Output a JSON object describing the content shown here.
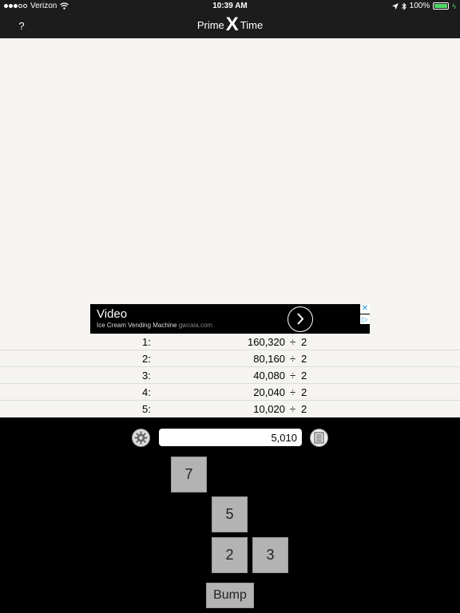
{
  "status_bar": {
    "carrier": "Verizon",
    "time": "10:39 AM",
    "battery_percent": "100%",
    "battery_level": 1.0,
    "signal_bars_filled": 3,
    "signal_bars_total": 5
  },
  "nav_bar": {
    "help_label": "?",
    "title_prefix": "Prime",
    "title_x": "X",
    "title_suffix": "Time"
  },
  "ad": {
    "title": "Video",
    "subtitle": "Ice Cream Vending Machine",
    "domain": "gwcaia.com",
    "close_label": "✕",
    "choices_label": "▷"
  },
  "factor_rows": [
    {
      "index": "1:",
      "value": "160,320",
      "divsign": "÷",
      "divisor": "2"
    },
    {
      "index": "2:",
      "value": "80,160",
      "divsign": "÷",
      "divisor": "2"
    },
    {
      "index": "3:",
      "value": "40,080",
      "divsign": "÷",
      "divisor": "2"
    },
    {
      "index": "4:",
      "value": "20,040",
      "divsign": "÷",
      "divisor": "2"
    },
    {
      "index": "5:",
      "value": "10,020",
      "divsign": "÷",
      "divisor": "2"
    }
  ],
  "keypad": {
    "input_value": "5,010",
    "keys": [
      "7",
      "5",
      "2",
      "3"
    ],
    "bump_label": "Bump"
  },
  "colors": {
    "bar_bg": "#1c1c1c",
    "main_bg": "#f5f4f0",
    "key_bg": "#b3b3b3",
    "battery_green": "#4cd964",
    "ad_choice_blue": "#1e9bd7"
  },
  "icons": {
    "settings": "gear-icon",
    "list": "list-icon",
    "wifi": "wifi-icon",
    "location": "location-arrow-icon",
    "bluetooth": "bluetooth-icon",
    "battery": "battery-icon",
    "ad_arrow": "chevron-right-icon"
  }
}
